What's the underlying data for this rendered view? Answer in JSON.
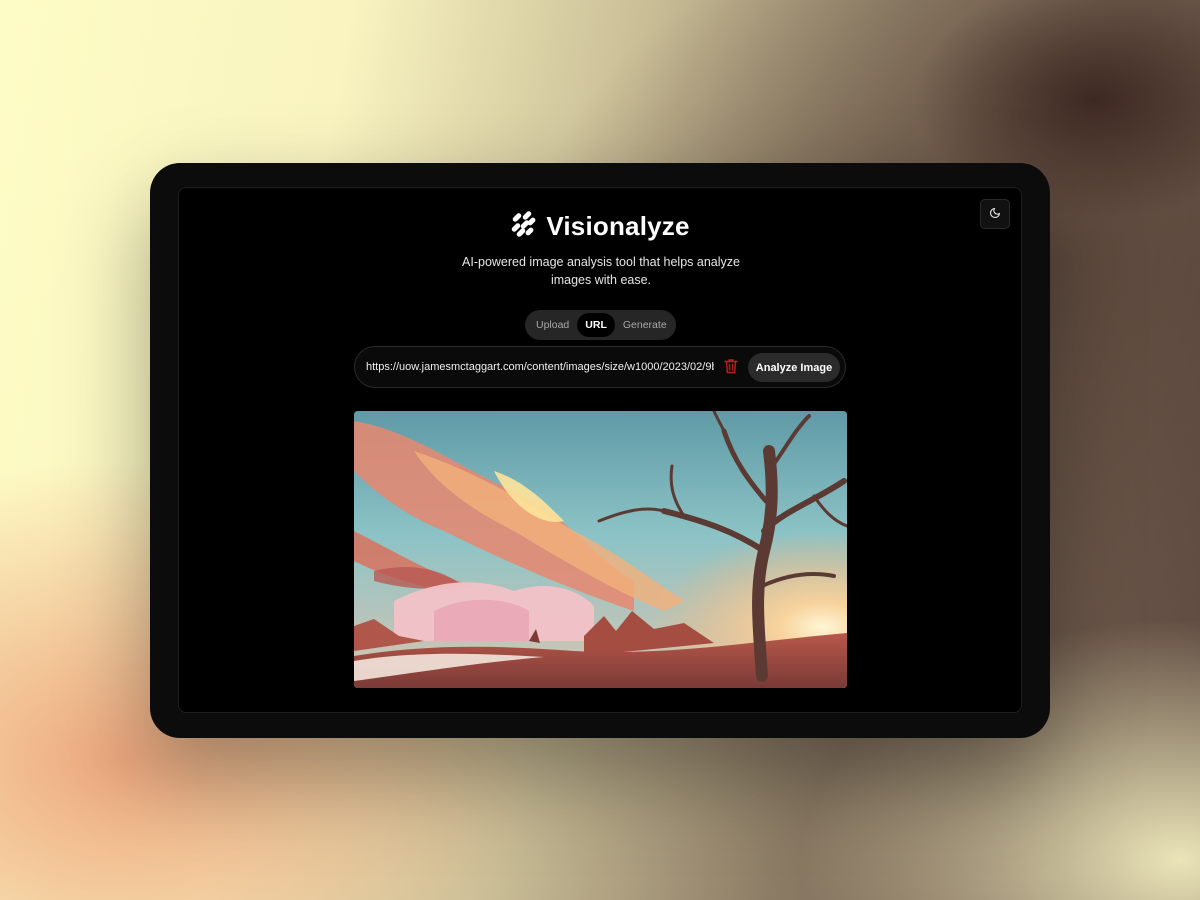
{
  "app": {
    "title": "Visionalyze",
    "tagline": "AI-powered image analysis tool that helps analyze images with ease.",
    "logo_icon": "logo-icon",
    "theme_toggle_icon": "moon-icon"
  },
  "tabs": [
    {
      "label": "Upload",
      "active": false
    },
    {
      "label": "URL",
      "active": true
    },
    {
      "label": "Generate",
      "active": false
    }
  ],
  "url_input": {
    "value": "https://uow.jamesmctaggart.com/content/images/size/w1000/2023/02/9b",
    "placeholder": ""
  },
  "actions": {
    "delete_icon": "trash-icon",
    "analyze_label": "Analyze Image"
  },
  "preview": {
    "image": "landscape-illustration"
  },
  "colors": {
    "delete_accent": "#b3261e",
    "surface": "#000000",
    "button": "#2b2b2b"
  }
}
